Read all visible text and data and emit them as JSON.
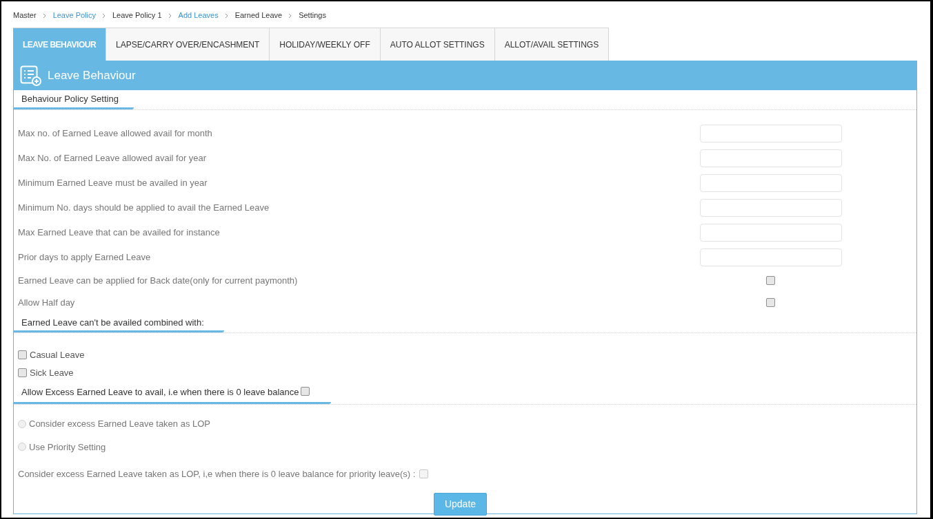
{
  "breadcrumb": [
    {
      "label": "Master",
      "kind": "text"
    },
    {
      "label": "Leave Policy",
      "kind": "link"
    },
    {
      "label": "Leave Policy 1",
      "kind": "text"
    },
    {
      "label": "Add Leaves",
      "kind": "link"
    },
    {
      "label": "Earned Leave",
      "kind": "text"
    },
    {
      "label": "Settings",
      "kind": "text"
    }
  ],
  "tabs": [
    {
      "label": "LEAVE BEHAVIOUR",
      "selected": true
    },
    {
      "label": "LAPSE/CARRY OVER/ENCASHMENT",
      "selected": false
    },
    {
      "label": "HOLIDAY/WEEKLY OFF",
      "selected": false
    },
    {
      "label": "AUTO ALLOT SETTINGS",
      "selected": false
    },
    {
      "label": "ALLOT/AVAIL SETTINGS",
      "selected": false
    }
  ],
  "panel_title": "Leave Behaviour",
  "section_1": {
    "title": "Behaviour Policy Setting",
    "rows": [
      {
        "kind": "input",
        "label": "Max no. of Earned Leave allowed avail for month"
      },
      {
        "kind": "input",
        "label": "Max No. of Earned Leave allowed avail for year"
      },
      {
        "kind": "input",
        "label": "Minimum Earned Leave must be availed in year"
      },
      {
        "kind": "input",
        "label": "Minimum No. days should be applied to avail the Earned Leave"
      },
      {
        "kind": "input",
        "label": "Max Earned Leave that can be availed for instance"
      },
      {
        "kind": "input",
        "label": "Prior days to apply Earned Leave"
      },
      {
        "kind": "checkbox",
        "label": "Earned Leave can be applied for Back date(only for current paymonth)",
        "checked": false
      },
      {
        "kind": "checkbox",
        "label": "Allow Half day",
        "checked": false
      }
    ]
  },
  "section_2": {
    "title": "Earned Leave can't be availed combined with:",
    "options": [
      {
        "label": "Casual Leave",
        "checked": false
      },
      {
        "label": "Sick Leave",
        "checked": false
      }
    ]
  },
  "section_3": {
    "title": "Allow Excess Earned Leave to avail, i.e when there is 0 leave balance",
    "checked": false,
    "radios": [
      {
        "label": "Consider excess Earned Leave taken as LOP",
        "selected": false,
        "disabled": true
      },
      {
        "label": "Use Priority Setting",
        "selected": false,
        "disabled": true
      }
    ],
    "priority_lop": {
      "label": "Consider excess Earned Leave taken as LOP, i,e when there is 0 leave balance for priority leave(s) :",
      "checked": false,
      "disabled": true
    }
  },
  "update_button": "Update"
}
